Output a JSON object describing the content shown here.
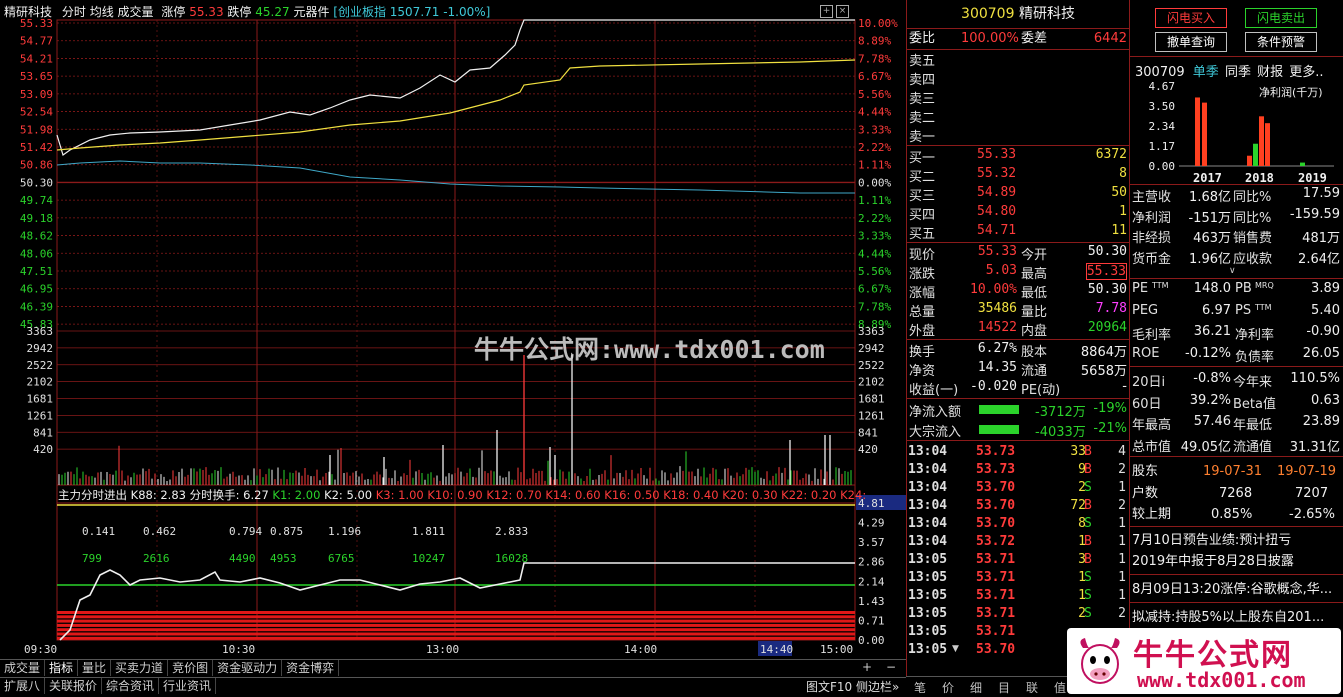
{
  "header": {
    "stock_name": "精研科技",
    "mode": "分时",
    "avg_line": "均线",
    "volume": "成交量",
    "limit_up_label": "涨停",
    "limit_up": "55.33",
    "limit_down_label": "跌停",
    "limit_down": "45.27",
    "sector": "元器件",
    "index_info": "[创业板指 1507.71 -1.00%]"
  },
  "price_axis_left": [
    "55.33",
    "54.77",
    "54.21",
    "53.65",
    "53.09",
    "52.54",
    "51.98",
    "51.42",
    "50.86",
    "50.30",
    "49.74",
    "49.18",
    "48.62",
    "48.06",
    "47.51",
    "46.95",
    "46.39",
    "45.83"
  ],
  "pct_axis_right": [
    "10.00%",
    "8.89%",
    "7.78%",
    "6.67%",
    "5.56%",
    "4.44%",
    "3.33%",
    "2.22%",
    "1.11%",
    "0.00%",
    "1.11%",
    "2.22%",
    "3.33%",
    "4.44%",
    "5.56%",
    "6.67%",
    "7.78%",
    "8.89%"
  ],
  "vol_axis": [
    "3363",
    "2942",
    "2522",
    "2102",
    "1681",
    "1261",
    "841",
    "420"
  ],
  "indicator_title": {
    "name": "主力分时进出",
    "k88": "K88: 2.83",
    "turn": "分时换手: 6.27",
    "k1": "K1: 2.00",
    "k2": "K2: 5.00",
    "rest": "K3: 1.00  K10: 0.90  K12: 0.70  K14: 0.60  K16: 0.50  K18: 0.40  K20: 0.30  K22: 0.20  K24:"
  },
  "indicator_axis": [
    "4.81",
    "4.29",
    "3.57",
    "2.86",
    "2.14",
    "1.43",
    "0.71",
    "0.00"
  ],
  "indicator_labels_top": [
    "0.141",
    "0.462",
    "0.794",
    "0.875",
    "1.196",
    "1.811",
    "2.833"
  ],
  "indicator_labels_mid": [
    "799",
    "2616",
    "4490",
    "4953",
    "6765",
    "10247",
    "16028"
  ],
  "time_axis": [
    "09:30",
    "10:30",
    "13:00",
    "14:00",
    "14:40",
    "15:00"
  ],
  "bottom_tabs": [
    "成交量",
    "指标",
    "量比",
    "买卖力道",
    "竞价图",
    "资金驱动力",
    "资金博弈"
  ],
  "bottom_tabs2": [
    "扩展八",
    "关联报价",
    "综合资讯",
    "行业资讯"
  ],
  "bottom_right": [
    "图文F10",
    "侧边栏»"
  ],
  "watermark": "牛牛公式网:www.tdx001.com",
  "quote": {
    "code": "300709",
    "name": "精研科技",
    "weibi_label": "委比",
    "weibi": "100.00%",
    "weicha_label": "委差",
    "weicha": "6442",
    "sells": [
      {
        "label": "卖五",
        "price": "",
        "vol": ""
      },
      {
        "label": "卖四",
        "price": "",
        "vol": ""
      },
      {
        "label": "卖三",
        "price": "",
        "vol": ""
      },
      {
        "label": "卖二",
        "price": "",
        "vol": ""
      },
      {
        "label": "卖一",
        "price": "",
        "vol": ""
      }
    ],
    "buys": [
      {
        "label": "买一",
        "price": "55.33",
        "vol": "6372"
      },
      {
        "label": "买二",
        "price": "55.32",
        "vol": "8"
      },
      {
        "label": "买三",
        "price": "54.89",
        "vol": "50"
      },
      {
        "label": "买四",
        "price": "54.80",
        "vol": "1"
      },
      {
        "label": "买五",
        "price": "54.71",
        "vol": "11"
      }
    ],
    "stats": [
      {
        "l1": "现价",
        "v1": "55.33",
        "c1": "red",
        "l2": "今开",
        "v2": "50.30",
        "c2": "white"
      },
      {
        "l1": "涨跌",
        "v1": "5.03",
        "c1": "red",
        "l2": "最高",
        "v2": "55.33",
        "c2": "red"
      },
      {
        "l1": "涨幅",
        "v1": "10.00%",
        "c1": "red",
        "l2": "最低",
        "v2": "50.30",
        "c2": "white"
      },
      {
        "l1": "总量",
        "v1": "35486",
        "c1": "yellow",
        "l2": "量比",
        "v2": "7.78",
        "c2": "magenta"
      },
      {
        "l1": "外盘",
        "v1": "14522",
        "c1": "red",
        "l2": "内盘",
        "v2": "20964",
        "c2": "green"
      }
    ],
    "stats2": [
      {
        "l1": "换手",
        "v1": "6.27%",
        "l2": "股本",
        "v2": "8864万"
      },
      {
        "l1": "净资",
        "v1": "14.35",
        "l2": "流通",
        "v2": "5658万"
      },
      {
        "l1": "收益(一)",
        "v1": "-0.020",
        "l2": "PE(动)",
        "v2": "-"
      }
    ],
    "flow": [
      {
        "label": "净流入额",
        "value": "-3712万",
        "pct": "-19%"
      },
      {
        "label": "大宗流入",
        "value": "-4033万",
        "pct": "-21%"
      }
    ]
  },
  "ticks": [
    {
      "t": "13:04",
      "p": "53.73",
      "v": "33",
      "d": "B",
      "n": "4"
    },
    {
      "t": "13:04",
      "p": "53.73",
      "v": "9",
      "d": "B",
      "n": "2"
    },
    {
      "t": "13:04",
      "p": "53.70",
      "v": "2",
      "d": "S",
      "n": "1"
    },
    {
      "t": "13:04",
      "p": "53.70",
      "v": "72",
      "d": "B",
      "n": "2"
    },
    {
      "t": "13:04",
      "p": "53.70",
      "v": "8",
      "d": "S",
      "n": "1"
    },
    {
      "t": "13:04",
      "p": "53.72",
      "v": "1",
      "d": "B",
      "n": "1"
    },
    {
      "t": "13:05",
      "p": "53.71",
      "v": "3",
      "d": "B",
      "n": "1"
    },
    {
      "t": "13:05",
      "p": "53.71",
      "v": "1",
      "d": "S",
      "n": "1"
    },
    {
      "t": "13:05",
      "p": "53.71",
      "v": "1",
      "d": "S",
      "n": "1"
    },
    {
      "t": "13:05",
      "p": "53.71",
      "v": "2",
      "d": "S",
      "n": "2"
    },
    {
      "t": "13:05",
      "p": "53.71",
      "v": "",
      "d": "",
      "n": ""
    },
    {
      "t": "13:05",
      "p": "53.70",
      "v": "",
      "d": "",
      "n": ""
    }
  ],
  "tick_tabs": [
    "笔",
    "价",
    "细",
    "目",
    "联",
    "值"
  ],
  "right": {
    "btn_buy": "闪电买入",
    "btn_sell": "闪电卖出",
    "btn_cancel": "撤单查询",
    "btn_cond": "条件预警",
    "fin_tabs": [
      "300709",
      "单季",
      "同季",
      "财报",
      "更多.."
    ],
    "fin_unit": "净利润(千万)",
    "fin_axis": [
      "4.67",
      "3.50",
      "2.34",
      "1.17",
      "0.00"
    ],
    "fin_years": [
      "2017",
      "2018",
      "2019"
    ],
    "fin_bars": [
      {
        "year_idx": 0,
        "value": 4.0,
        "color": "#ff4020"
      },
      {
        "year_idx": 0,
        "value": 3.7,
        "color": "#ff4020"
      },
      {
        "year_idx": 1,
        "value": 0.6,
        "color": "#ff4020"
      },
      {
        "year_idx": 1,
        "value": 1.3,
        "color": "#2bd32b"
      },
      {
        "year_idx": 1,
        "value": 2.9,
        "color": "#ff4020"
      },
      {
        "year_idx": 1,
        "value": 2.5,
        "color": "#ff4020"
      },
      {
        "year_idx": 2,
        "value": 0.2,
        "color": "#2bd32b"
      }
    ],
    "fin_rows": [
      {
        "l1": "主营收",
        "v1": "1.68亿",
        "l2": "同比%",
        "v2": "17.59"
      },
      {
        "l1": "净利润",
        "v1": "-151万",
        "l2": "同比%",
        "v2": "-159.59"
      },
      {
        "l1": "非经损",
        "v1": "463万",
        "l2": "销售费",
        "v2": "481万"
      },
      {
        "l1": "货币金",
        "v1": "1.96亿",
        "l2": "应收款",
        "v2": "2.64亿"
      }
    ],
    "val_rows": [
      {
        "l1": "PE",
        "s1": "TTM",
        "v1": "148.0",
        "l2": "PB",
        "s2": "MRQ",
        "v2": "3.89"
      },
      {
        "l1": "PEG",
        "s1": "",
        "v1": "6.97",
        "l2": "PS",
        "s2": "TTM",
        "v2": "5.40"
      },
      {
        "l1": "毛利率",
        "s1": "",
        "v1": "36.21",
        "l2": "净利率",
        "s2": "",
        "v2": "-0.90"
      },
      {
        "l1": "ROE",
        "s1": "",
        "v1": "-0.12%",
        "l2": "负债率",
        "s2": "",
        "v2": "26.05"
      }
    ],
    "perf_rows": [
      {
        "l1": "20日i",
        "v1": "-0.8%",
        "l2": "今年来",
        "v2": "110.5%"
      },
      {
        "l1": "60日",
        "v1": "39.2%",
        "l2": "Beta值",
        "v2": "0.63"
      },
      {
        "l1": "年最高",
        "v1": "57.46",
        "l2": "年最低",
        "v2": "23.89"
      },
      {
        "l1": "总市值",
        "v1": "49.05亿",
        "l2": "流通值",
        "v2": "31.31亿"
      }
    ],
    "holder": {
      "label": "股东",
      "d1": "19-07-31",
      "d2": "19-07-19",
      "r1l": "户数",
      "r1a": "7268",
      "r1b": "7207",
      "r2l": "较上期",
      "r2a": "0.85%",
      "r2b": "-2.65%"
    },
    "news": [
      "7月10日预告业绩:预计扭亏",
      "2019年中报于8月28日披露",
      "8月09日13:20涨停:谷歌概念,华...",
      "拟减持:持股5%以上股东自201..."
    ],
    "logo_text": "牛牛公式网",
    "logo_url": "www.tdx001.com"
  }
}
